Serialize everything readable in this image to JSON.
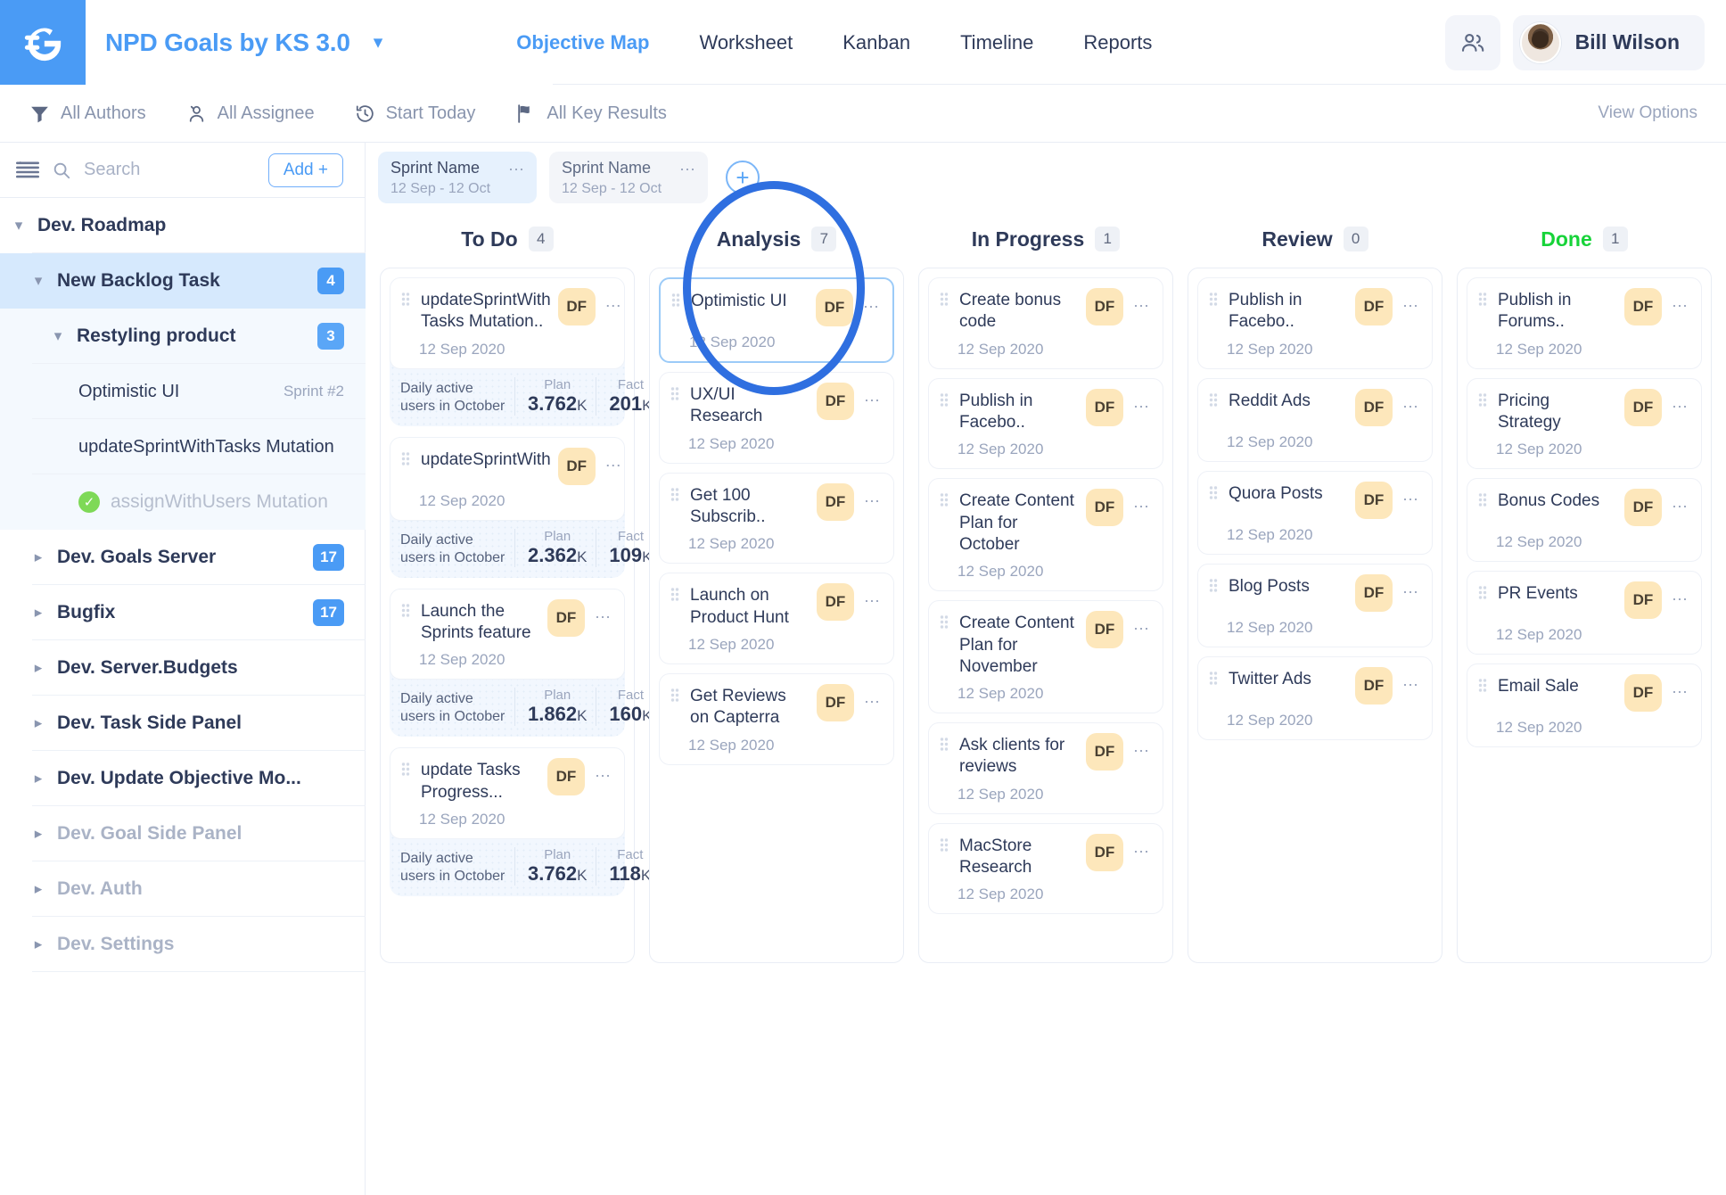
{
  "app": {
    "logo_icon": "gtd-logo-icon",
    "project_title": "NPD Goals by KS 3.0",
    "project_dropdown_icon": "chevron-down-icon"
  },
  "nav": {
    "tabs": [
      {
        "label": "Objective Map",
        "active": true
      },
      {
        "label": "Worksheet",
        "active": false
      },
      {
        "label": "Kanban",
        "active": false
      },
      {
        "label": "Timeline",
        "active": false
      },
      {
        "label": "Reports",
        "active": false
      }
    ]
  },
  "topbar_right": {
    "people_icon": "people-icon",
    "user_name": "Bill Wilson",
    "avatar_icon": "avatar"
  },
  "filterbar": {
    "items": [
      {
        "label": "All Authors",
        "icon": "funnel-icon"
      },
      {
        "label": "All Assignee",
        "icon": "person-icon"
      },
      {
        "label": "Start Today",
        "icon": "clock-rewind-icon"
      },
      {
        "label": "All Key Results",
        "icon": "flag-icon"
      }
    ],
    "view_options": "View Options"
  },
  "sidebar": {
    "hamburger_icon": "list-menu-icon",
    "search_icon": "search-icon",
    "search_placeholder": "Search",
    "search_value": "",
    "add_label": "Add +",
    "tree": [
      {
        "label": "Dev. Roadmap",
        "level": 1,
        "expanded": true,
        "badge": "",
        "state": "normal"
      },
      {
        "label": "New Backlog Task",
        "level": 2,
        "expanded": true,
        "badge": "4",
        "state": "selected"
      },
      {
        "label": "Restyling product",
        "level": 3,
        "expanded": true,
        "badge": "3",
        "state": "sub"
      },
      {
        "label": "Optimistic UI",
        "level": 4,
        "expanded": null,
        "badge": "",
        "tag": "Sprint #2",
        "state": "sub-leaf"
      },
      {
        "label": "updateSprintWithTasks Mutation",
        "level": 4,
        "expanded": null,
        "badge": "",
        "state": "sub-leaf"
      },
      {
        "label": "assignWithUsers Mutation",
        "level": 4,
        "expanded": null,
        "badge": "",
        "state": "sub-leaf-done",
        "done": true
      },
      {
        "label": "Dev. Goals Server",
        "level": 1,
        "expanded": false,
        "badge": "17",
        "state": "normal"
      },
      {
        "label": "Bugfix",
        "level": 1,
        "expanded": false,
        "badge": "17",
        "state": "normal"
      },
      {
        "label": "Dev. Server.Budgets",
        "level": 1,
        "expanded": false,
        "badge": "",
        "state": "normal"
      },
      {
        "label": "Dev. Task Side Panel",
        "level": 1,
        "expanded": false,
        "badge": "",
        "state": "normal"
      },
      {
        "label": "Dev. Update Objective Mo...",
        "level": 1,
        "expanded": false,
        "badge": "",
        "state": "normal"
      },
      {
        "label": "Dev. Goal Side Panel",
        "level": 1,
        "expanded": false,
        "badge": "",
        "state": "muted"
      },
      {
        "label": "Dev. Auth",
        "level": 1,
        "expanded": false,
        "badge": "",
        "state": "muted"
      },
      {
        "label": "Dev. Settings",
        "level": 1,
        "expanded": false,
        "badge": "",
        "state": "muted"
      }
    ]
  },
  "board": {
    "sprints": [
      {
        "name": "Sprint Name",
        "range": "12 Sep - 12 Oct",
        "active": true,
        "menu_icon": "ellipsis-icon"
      },
      {
        "name": "Sprint Name",
        "range": "12 Sep - 12 Oct",
        "active": false,
        "menu_icon": "ellipsis-icon"
      }
    ],
    "add_sprint_icon": "plus-circle-icon",
    "columns": [
      {
        "title": "To Do",
        "count": "4",
        "accent": "default",
        "cards": [
          {
            "title": "updateSprintWith Tasks Mutation..",
            "date": "12 Sep 2020",
            "assignee": "DF",
            "highlight": false,
            "kr": {
              "name": "Daily active users in October",
              "plan_label": "Plan",
              "plan_value": "3.762",
              "plan_unit": "K",
              "fact_label": "Fact",
              "fact_value": "201",
              "fact_unit": "K"
            }
          },
          {
            "title": "updateSprintWith",
            "date": "12 Sep 2020",
            "assignee": "DF",
            "highlight": false,
            "kr": {
              "name": "Daily active users in October",
              "plan_label": "Plan",
              "plan_value": "2.362",
              "plan_unit": "K",
              "fact_label": "Fact",
              "fact_value": "109",
              "fact_unit": "K"
            }
          },
          {
            "title": "Launch the Sprints feature",
            "date": "12 Sep 2020",
            "assignee": "DF",
            "highlight": false,
            "kr": {
              "name": "Daily active users in October",
              "plan_label": "Plan",
              "plan_value": "1.862",
              "plan_unit": "K",
              "fact_label": "Fact",
              "fact_value": "160",
              "fact_unit": "K"
            }
          },
          {
            "title": "update Tasks Progress...",
            "date": "12 Sep 2020",
            "assignee": "DF",
            "highlight": false,
            "kr": {
              "name": "Daily active users in October",
              "plan_label": "Plan",
              "plan_value": "3.762",
              "plan_unit": "K",
              "fact_label": "Fact",
              "fact_value": "118",
              "fact_unit": "K"
            }
          }
        ]
      },
      {
        "title": "Analysis",
        "count": "7",
        "accent": "default",
        "cards": [
          {
            "title": "Optimistic UI",
            "date": "12 Sep 2020",
            "assignee": "DF",
            "highlight": true
          },
          {
            "title": "UX/UI Research",
            "date": "12 Sep 2020",
            "assignee": "DF",
            "highlight": false
          },
          {
            "title": "Get 100 Subscrib..",
            "date": "12 Sep 2020",
            "assignee": "DF",
            "highlight": false
          },
          {
            "title": "Launch on Product Hunt",
            "date": "12 Sep 2020",
            "assignee": "DF",
            "highlight": false
          },
          {
            "title": "Get Reviews on Capterra",
            "date": "12 Sep 2020",
            "assignee": "DF",
            "highlight": false
          }
        ]
      },
      {
        "title": "In Progress",
        "count": "1",
        "accent": "default",
        "cards": [
          {
            "title": "Create bonus code",
            "date": "12 Sep 2020",
            "assignee": "DF",
            "highlight": false
          },
          {
            "title": "Publish in Facebo..",
            "date": "12 Sep 2020",
            "assignee": "DF",
            "highlight": false
          },
          {
            "title": "Create Content Plan for October",
            "date": "12 Sep 2020",
            "assignee": "DF",
            "highlight": false
          },
          {
            "title": "Create Content Plan for November",
            "date": "12 Sep 2020",
            "assignee": "DF",
            "highlight": false
          },
          {
            "title": "Ask clients for reviews",
            "date": "12 Sep 2020",
            "assignee": "DF",
            "highlight": false
          },
          {
            "title": "MacStore Research",
            "date": "12 Sep 2020",
            "assignee": "DF",
            "highlight": false
          }
        ]
      },
      {
        "title": "Review",
        "count": "0",
        "accent": "default",
        "cards": [
          {
            "title": "Publish in Facebo..",
            "date": "12 Sep 2020",
            "assignee": "DF",
            "highlight": false
          },
          {
            "title": "Reddit Ads",
            "date": "12 Sep 2020",
            "assignee": "DF",
            "highlight": false
          },
          {
            "title": "Quora Posts",
            "date": "12 Sep 2020",
            "assignee": "DF",
            "highlight": false
          },
          {
            "title": "Blog Posts",
            "date": "12 Sep 2020",
            "assignee": "DF",
            "highlight": false
          },
          {
            "title": "Twitter Ads",
            "date": "12 Sep 2020",
            "assignee": "DF",
            "highlight": false
          }
        ]
      },
      {
        "title": "Done",
        "count": "1",
        "accent": "done",
        "cards": [
          {
            "title": "Publish in Forums..",
            "date": "12 Sep 2020",
            "assignee": "DF",
            "highlight": false
          },
          {
            "title": "Pricing Strategy",
            "date": "12 Sep 2020",
            "assignee": "DF",
            "highlight": false
          },
          {
            "title": "Bonus Codes",
            "date": "12 Sep 2020",
            "assignee": "DF",
            "highlight": false
          },
          {
            "title": "PR Events",
            "date": "12 Sep 2020",
            "assignee": "DF",
            "highlight": false
          },
          {
            "title": "Email Sale",
            "date": "12 Sep 2020",
            "assignee": "DF",
            "highlight": false
          }
        ]
      }
    ]
  },
  "annotation": {
    "shape": "ellipse-highlight",
    "color": "#2f6fe0"
  },
  "colors": {
    "brand_blue": "#4a9bf5",
    "done_green": "#17d339",
    "avatar_amber": "#fde7bb",
    "annotation_blue": "#2f6fe0"
  }
}
